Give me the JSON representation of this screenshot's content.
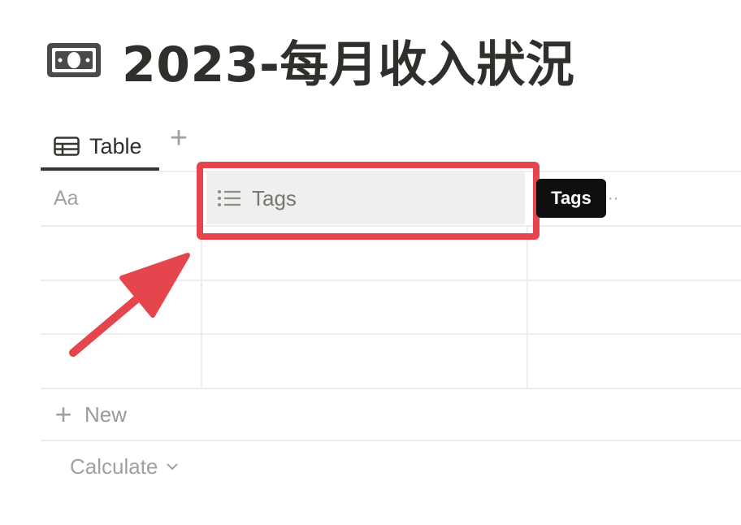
{
  "page": {
    "title": "2023-每月收入狀況",
    "title_icon": "money-bill-icon"
  },
  "views": {
    "active_tab_label": "Table",
    "add_view_glyph": "+"
  },
  "table": {
    "name_column_label": "Aa",
    "tags_column_label": "Tags",
    "new_row_label": "New",
    "new_row_glyph": "+",
    "calculate_label": "Calculate",
    "row_count": 3
  },
  "tooltip": {
    "text": "Tags"
  },
  "overflow": {
    "glyph": "··"
  },
  "annotation": {
    "highlight_color": "#e5464d",
    "arrow_color": "#e5464d"
  }
}
